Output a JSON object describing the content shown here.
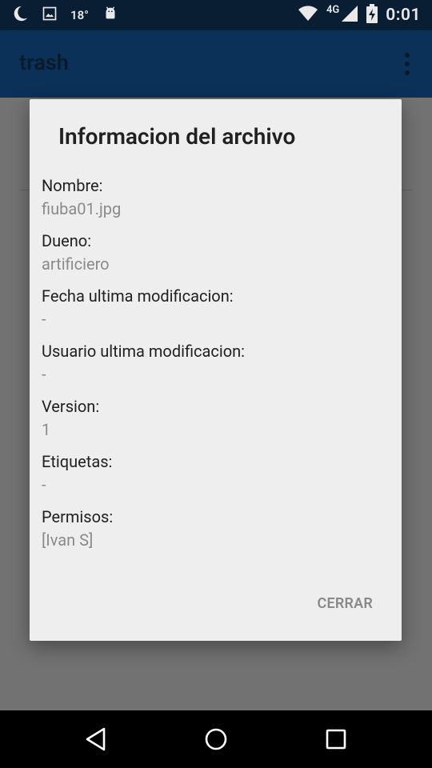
{
  "status_bar": {
    "temperature": "18°",
    "network": "4G",
    "time": "0:01"
  },
  "app_bar": {
    "title": "trash"
  },
  "dialog": {
    "title": "Informacion del archivo",
    "fields": [
      {
        "label": "Nombre:",
        "value": "fiuba01.jpg"
      },
      {
        "label": "Dueno:",
        "value": "artificiero"
      },
      {
        "label": "Fecha ultima modificacion:",
        "value": "-"
      },
      {
        "label": "Usuario ultima modificacion:",
        "value": "-"
      },
      {
        "label": "Version:",
        "value": "1"
      },
      {
        "label": "Etiquetas:",
        "value": "-"
      },
      {
        "label": "Permisos:",
        "value": "[Ivan S]"
      }
    ],
    "close_label": "CERRAR"
  },
  "icons": {
    "status_left": [
      "moon-icon",
      "image-icon",
      "android-icon"
    ],
    "status_right": [
      "wifi-icon",
      "signal-icon",
      "battery-charging-icon"
    ],
    "nav": [
      "back-icon",
      "home-icon",
      "recents-icon"
    ]
  },
  "colors": {
    "status_bar": "#0a1e33",
    "app_bar": "#0b3158",
    "dialog_bg": "#eeeeee",
    "scrim_bg": "#727272"
  }
}
